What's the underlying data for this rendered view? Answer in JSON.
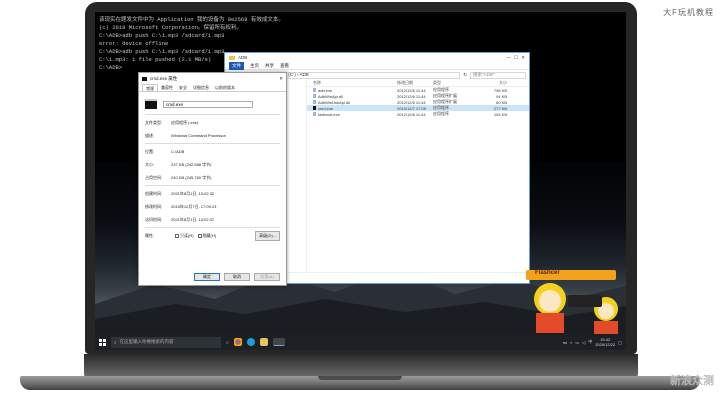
{
  "watermark_brand": "大F玩机教程",
  "watermark_site": "新浪众测",
  "cmd": {
    "lines": [
      "该现实在题发文件中为 Application 我的设备为 0e2568 有效成文本。",
      "(c) 2019 Microsoft Corporation。保留所有权利。",
      "",
      "C:\\ADB>adb push C:\\1.mp3 /sdcard/1.mp3",
      "error: device offline",
      "",
      "C:\\ADB>adb push C:\\1.mp3 /sdcard/1.mp3",
      "C:\\1.mp3: 1 file pushed (2.1 MB/s)",
      "",
      "C:\\ADB>"
    ]
  },
  "explorer": {
    "title": "ADB",
    "tabs": [
      "文件",
      "主页",
      "共享",
      "查看"
    ],
    "address": "此电脑 › Windows (C:) › ADB",
    "search_placeholder": "搜索\"ADB\"",
    "columns": [
      "名称",
      "修改日期",
      "类型",
      "大小"
    ],
    "files": [
      {
        "name": "adb.exe",
        "date": "2012/12/6 11:44",
        "type": "应用程序",
        "size": "796 KB"
      },
      {
        "name": "AdbWinApi.dll",
        "date": "2012/12/6 11:44",
        "type": "应用程序扩展",
        "size": "94 KB"
      },
      {
        "name": "AdbWinUsbApi.dll",
        "date": "2012/12/6 11:44",
        "type": "应用程序扩展",
        "size": "60 KB"
      },
      {
        "name": "cmd.exe",
        "date": "2019/12/7 17:09",
        "type": "应用程序",
        "size": "277 KB"
      },
      {
        "name": "fastboot.exe",
        "date": "2012/12/6 11:44",
        "type": "应用程序",
        "size": "154 KB"
      }
    ],
    "status": "5 个项目"
  },
  "props": {
    "title": "cmd.exe 属性",
    "tabs": [
      "常规",
      "兼容性",
      "安全",
      "详细信息",
      "以前的版本"
    ],
    "name_value": "cmd.exe",
    "rows_a": [
      {
        "k": "文件类型:",
        "v": "应用程序 (.exe)"
      },
      {
        "k": "描述:",
        "v": "Windows Command Processor"
      }
    ],
    "rows_b": [
      {
        "k": "位置:",
        "v": "C:\\ADB"
      },
      {
        "k": "大小:",
        "v": "237 KB (242,688 字节)"
      },
      {
        "k": "占用空间:",
        "v": "240 KB (245,760 字节)"
      }
    ],
    "rows_c": [
      {
        "k": "创建时间:",
        "v": "2021年8月1日, 13:02:32"
      },
      {
        "k": "修改时间:",
        "v": "2019年12月7日, 17:09:23"
      },
      {
        "k": "访问时间:",
        "v": "2021年8月1日, 13:02:37"
      }
    ],
    "attr_label": "属性:",
    "attr_readonly": "只读(R)",
    "attr_hidden": "隐藏(H)",
    "advanced_label": "高级(D)...",
    "ok": "确定",
    "cancel": "取消",
    "apply": "应用(A)"
  },
  "taskbar": {
    "search_placeholder": "在这里输入你要搜索的内容",
    "time": "15:42",
    "date": "2020/12/22",
    "lang": "中"
  },
  "mascot_label": "Flashcer"
}
